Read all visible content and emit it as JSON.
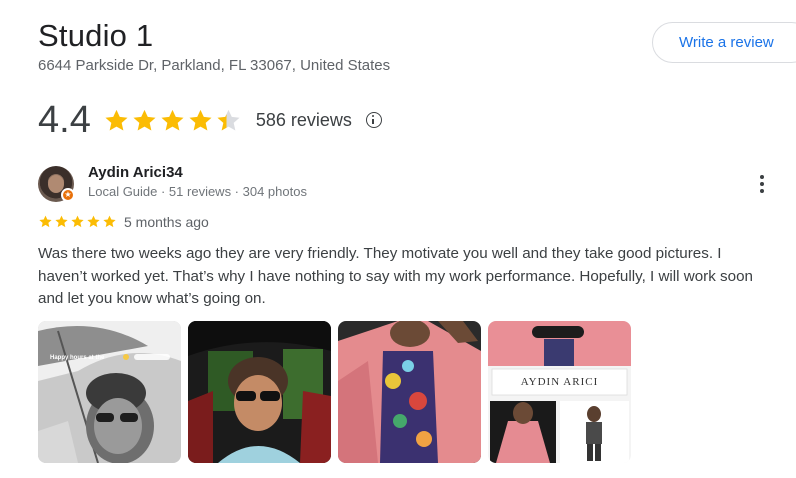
{
  "business": {
    "name": "Studio 1",
    "address": "6644 Parkside Dr, Parkland, FL 33067, United States",
    "write_review_label": "Write a review"
  },
  "rating": {
    "value": "4.4",
    "stars": 4.4,
    "review_count_label": "586 reviews",
    "star_color": "#fbbc04",
    "empty_star_color": "#dadce0"
  },
  "review": {
    "reviewer_name": "Aydin Arici34",
    "reviewer_meta": "Local Guide · 51 reviews · 304 photos",
    "stars": 5,
    "time_ago": "5 months ago",
    "text": "Was there two weeks ago they are very friendly. They motivate you well and they take good pictures. I haven’t worked yet. That’s why I have nothing to say with my work performance. Hopefully, I will work soon and let you know what’s going on.",
    "photos": [
      {
        "caption": "Happy hours at the",
        "icon": "photo-selfie-bw"
      },
      {
        "icon": "photo-car-selfie"
      },
      {
        "icon": "photo-pink-jacket"
      },
      {
        "caption": "AYDIN ARICI",
        "icon": "photo-collage"
      }
    ]
  },
  "colors": {
    "accent": "#1a73e8",
    "text_primary": "#202124",
    "text_secondary": "#5f6368",
    "badge": "#e8710a"
  }
}
